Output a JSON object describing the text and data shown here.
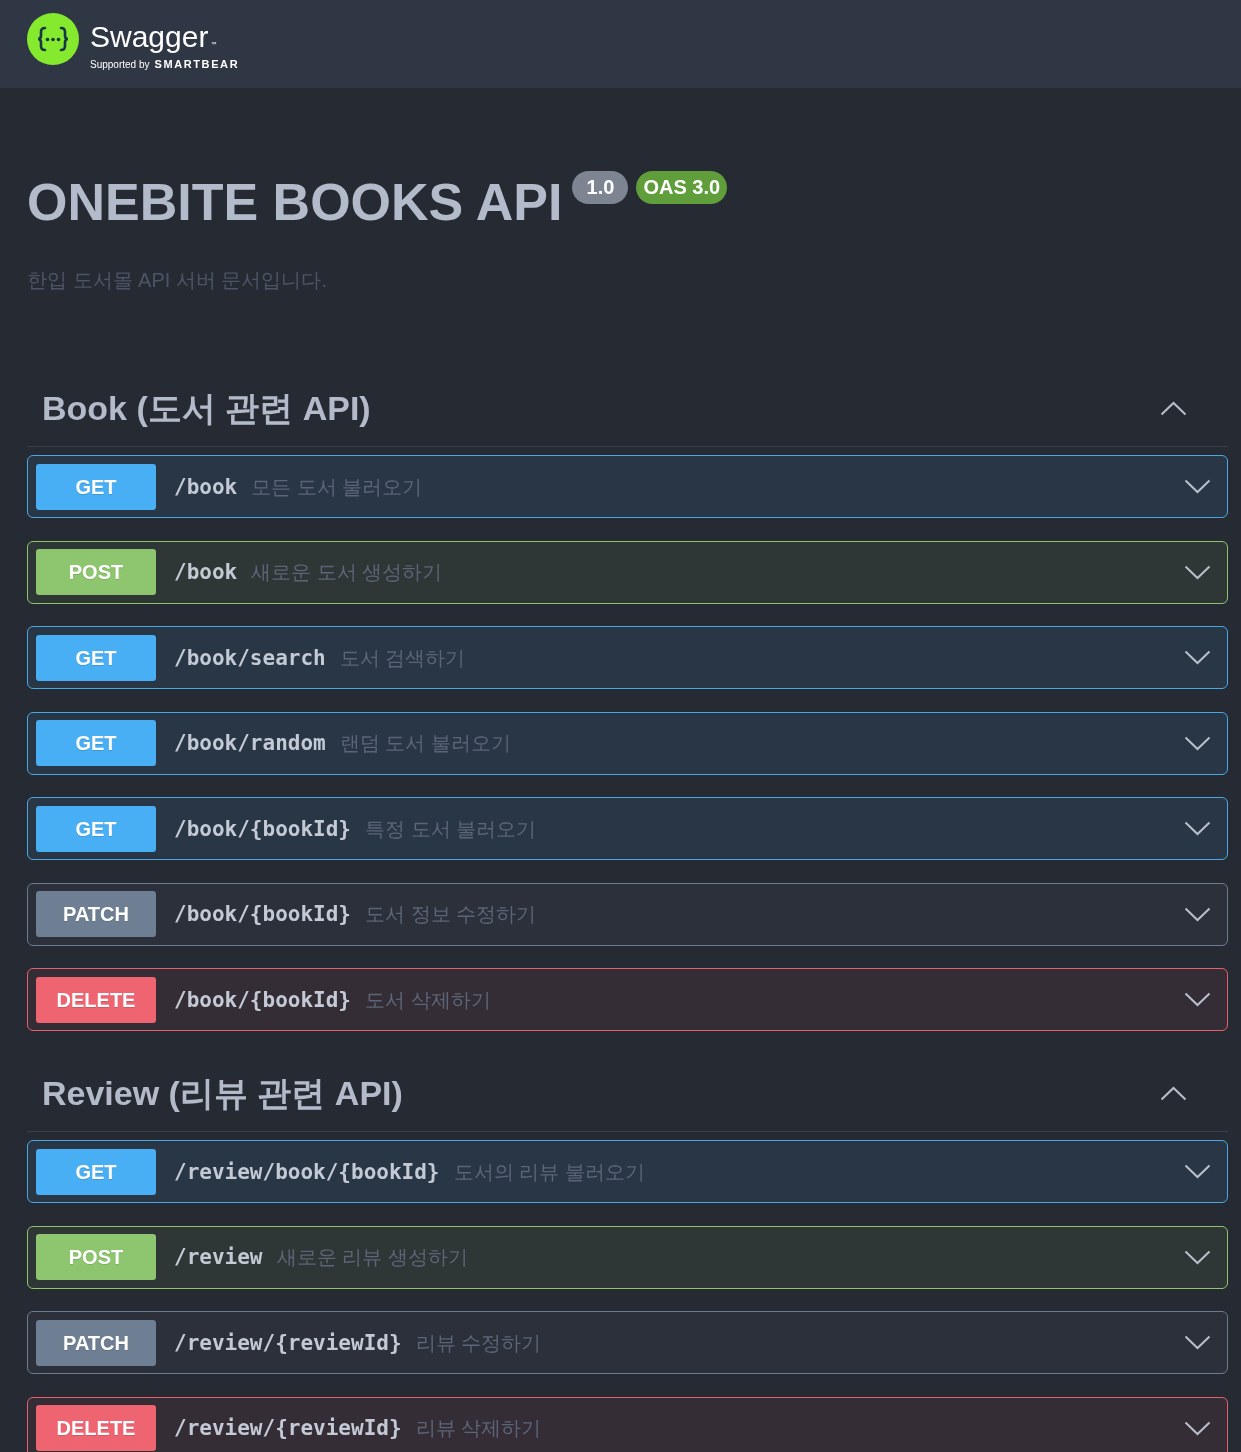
{
  "header": {
    "brand": "Swagger",
    "trademark": "™",
    "tagline": "Supported by",
    "sponsor": "SMARTBEAR"
  },
  "info": {
    "title": "ONEBITE BOOKS API",
    "version": "1.0",
    "oas": "OAS 3.0",
    "description": "한입 도서몰 API 서버 문서입니다."
  },
  "tags": [
    {
      "name": "Book (도서 관련 API)",
      "expanded": true,
      "operations": [
        {
          "kind": "get",
          "method": "GET",
          "path": "/book",
          "summary": "모든 도서 불러오기",
          "expanded": false
        },
        {
          "kind": "post",
          "method": "POST",
          "path": "/book",
          "summary": "새로운 도서 생성하기",
          "expanded": false
        },
        {
          "kind": "get",
          "method": "GET",
          "path": "/book/search",
          "summary": "도서 검색하기",
          "expanded": false
        },
        {
          "kind": "get",
          "method": "GET",
          "path": "/book/random",
          "summary": "랜덤 도서 불러오기",
          "expanded": false
        },
        {
          "kind": "get",
          "method": "GET",
          "path": "/book/{bookId}",
          "summary": "특정 도서 불러오기",
          "expanded": false
        },
        {
          "kind": "patch",
          "method": "PATCH",
          "path": "/book/{bookId}",
          "summary": "도서 정보 수정하기",
          "expanded": false
        },
        {
          "kind": "delete",
          "method": "DELETE",
          "path": "/book/{bookId}",
          "summary": "도서 삭제하기",
          "expanded": false
        }
      ]
    },
    {
      "name": "Review (리뷰 관련 API)",
      "expanded": true,
      "operations": [
        {
          "kind": "get",
          "method": "GET",
          "path": "/review/book/{bookId}",
          "summary": "도서의 리뷰 불러오기",
          "expanded": false
        },
        {
          "kind": "post",
          "method": "POST",
          "path": "/review",
          "summary": "새로운 리뷰 생성하기",
          "expanded": false
        },
        {
          "kind": "patch",
          "method": "PATCH",
          "path": "/review/{reviewId}",
          "summary": "리뷰 수정하기",
          "expanded": false
        },
        {
          "kind": "delete",
          "method": "DELETE",
          "path": "/review/{reviewId}",
          "summary": "리뷰 삭제하기",
          "expanded": false
        }
      ]
    }
  ]
}
